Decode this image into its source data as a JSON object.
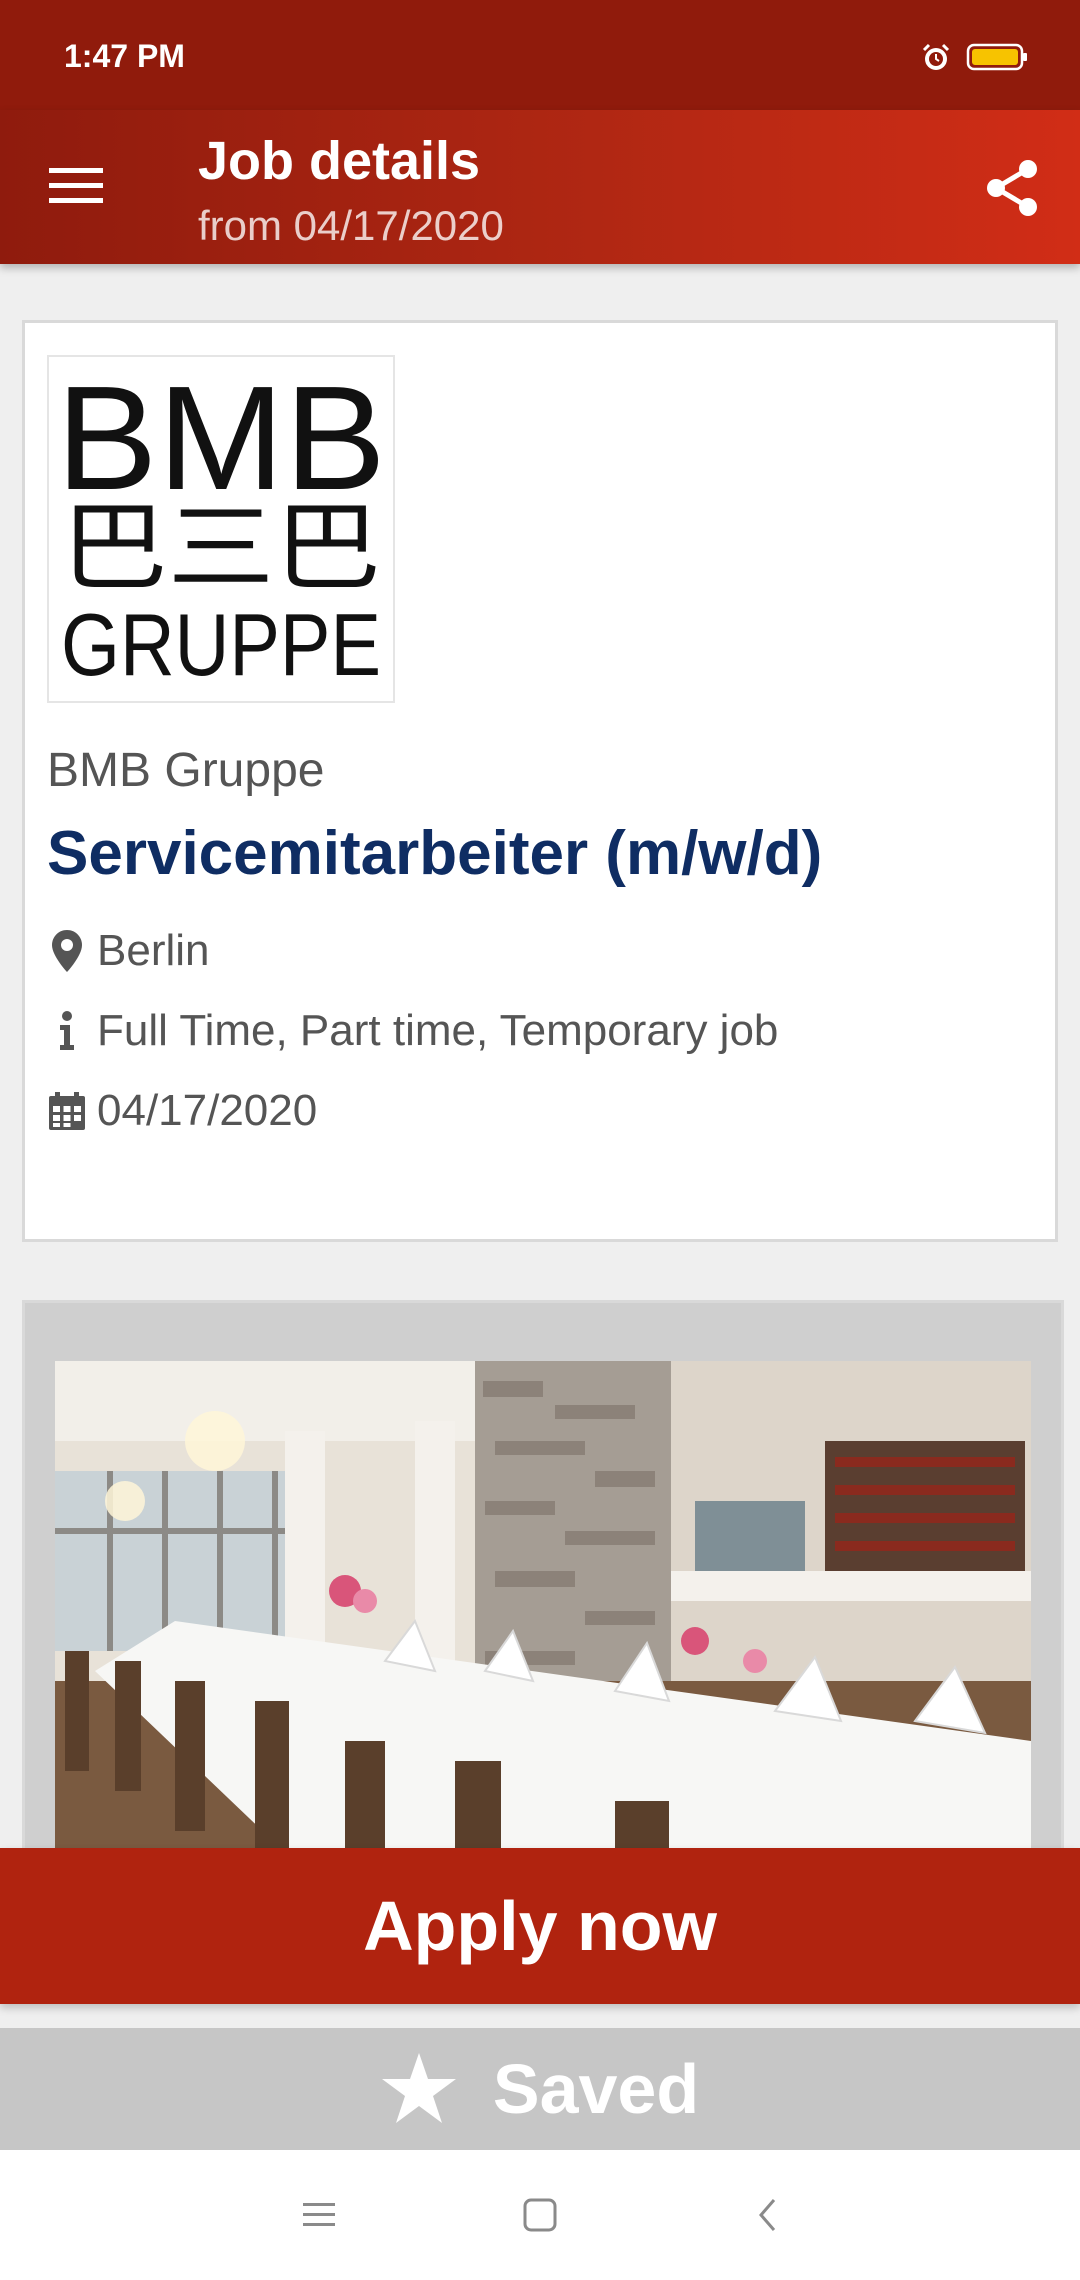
{
  "status_bar": {
    "time": "1:47 PM",
    "icons": [
      "alarm-icon",
      "battery-icon"
    ],
    "battery_color": "#f7c300"
  },
  "app_bar": {
    "title": "Job details",
    "subtitle": "from 04/17/2020",
    "menu_icon": "hamburger-menu-icon",
    "share_icon": "share-icon",
    "gradient_colors": [
      "#8f1b0d",
      "#d12d16"
    ]
  },
  "job": {
    "logo": {
      "line1": "BMB",
      "line2": "巴三巴",
      "line3": "GRUPPE"
    },
    "company": "BMB Gruppe",
    "title": "Servicemitarbeiter (m/w/d)",
    "location": "Berlin",
    "employment_type": "Full Time, Part time, Temporary job",
    "date": "04/17/2020",
    "title_color": "#0f2d63"
  },
  "photo": {
    "icon": "restaurant-photo"
  },
  "actions": {
    "apply_label": "Apply now",
    "saved_label": "Saved",
    "apply_color": "#b0230f",
    "saved_color": "#c6c6c6"
  },
  "nav_bar": {
    "icons": [
      "recents-icon",
      "home-icon",
      "back-icon"
    ]
  }
}
